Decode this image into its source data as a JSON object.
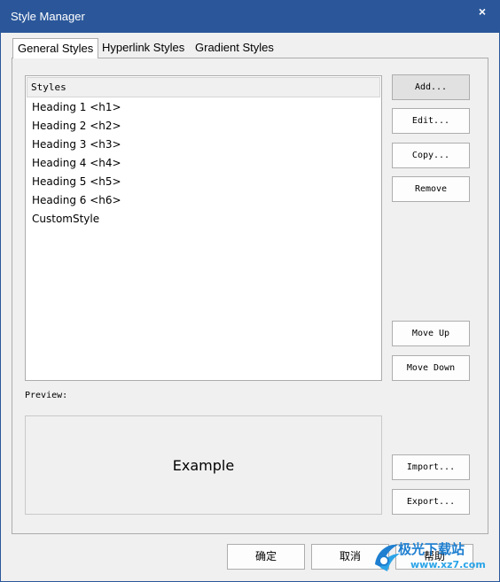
{
  "window": {
    "title": "Style Manager",
    "close_glyph": "×"
  },
  "tabs": [
    {
      "label": "General Styles",
      "active": true
    },
    {
      "label": "Hyperlink Styles",
      "active": false
    },
    {
      "label": "Gradient Styles",
      "active": false
    }
  ],
  "styles_list": {
    "header": "Styles",
    "items": [
      "Heading 1 <h1>",
      "Heading 2 <h2>",
      "Heading 3 <h3>",
      "Heading 4 <h4>",
      "Heading 5 <h5>",
      "Heading 6 <h6>",
      "CustomStyle"
    ]
  },
  "side_buttons": {
    "add": "Add...",
    "edit": "Edit...",
    "copy": "Copy...",
    "remove": "Remove",
    "move_up": "Move Up",
    "move_down": "Move Down",
    "import": "Import...",
    "export": "Export..."
  },
  "preview": {
    "label": "Preview:",
    "text": "Example"
  },
  "bottom_buttons": {
    "ok": "确定",
    "cancel": "取消",
    "help": "帮助"
  },
  "watermark": {
    "name": "极光下载站",
    "url": "www.xz7.com"
  },
  "colors": {
    "titlebar": "#2b579a",
    "watermark": "#1e7fd0"
  }
}
